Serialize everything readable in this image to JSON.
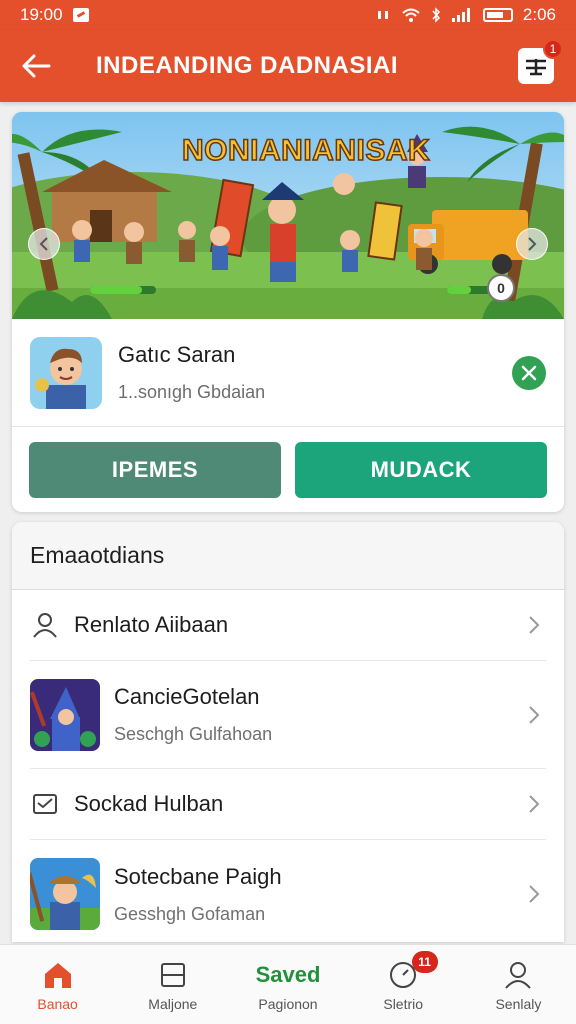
{
  "status_bar": {
    "time": "19:00",
    "clock_right": "2:06",
    "brand_color": "#e5502c"
  },
  "app_bar": {
    "title": "INDEANDING DADNASIAI",
    "back_icon": "arrow-left-icon",
    "menu_icon": "menu-icon",
    "menu_badge": "1"
  },
  "banner": {
    "title": "NONIANIANISAK",
    "page_indicator": "0"
  },
  "game": {
    "name": "Gatıc Saran",
    "subtitle": "1..sonıgh Gbdaian",
    "action_icon": "close-icon",
    "primary_button": "IPEMES",
    "secondary_button": "MUDACK",
    "colors": {
      "primary": "#4f8a76",
      "secondary": "#1ca57a",
      "action": "#31a253"
    }
  },
  "section": {
    "title": "Emaaotdians",
    "items": [
      {
        "title": "Renlato Aiibaan",
        "subtitle": "",
        "icon": "user-icon"
      },
      {
        "title": "CancieGotelan",
        "subtitle": "Seschgh Gulfahoan",
        "icon": "wizard-thumbnail"
      },
      {
        "title": "Sockad Hulban",
        "subtitle": "",
        "icon": "message-icon"
      },
      {
        "title": "Sotecbane Paigh",
        "subtitle": "Gesshgh Gofaman",
        "icon": "farmer-thumbnail"
      }
    ]
  },
  "bottom_nav": {
    "items": [
      {
        "label": "Banao",
        "icon": "home-icon",
        "active": true
      },
      {
        "label": "Maljone",
        "icon": "square-icon",
        "active": false
      },
      {
        "label": "Pagionon",
        "icon_text": "Saved",
        "active": false
      },
      {
        "label": "Sletrio",
        "icon": "compass-icon",
        "badge": "11",
        "active": false
      },
      {
        "label": "Senlaly",
        "icon": "profile-icon",
        "active": false
      }
    ]
  }
}
